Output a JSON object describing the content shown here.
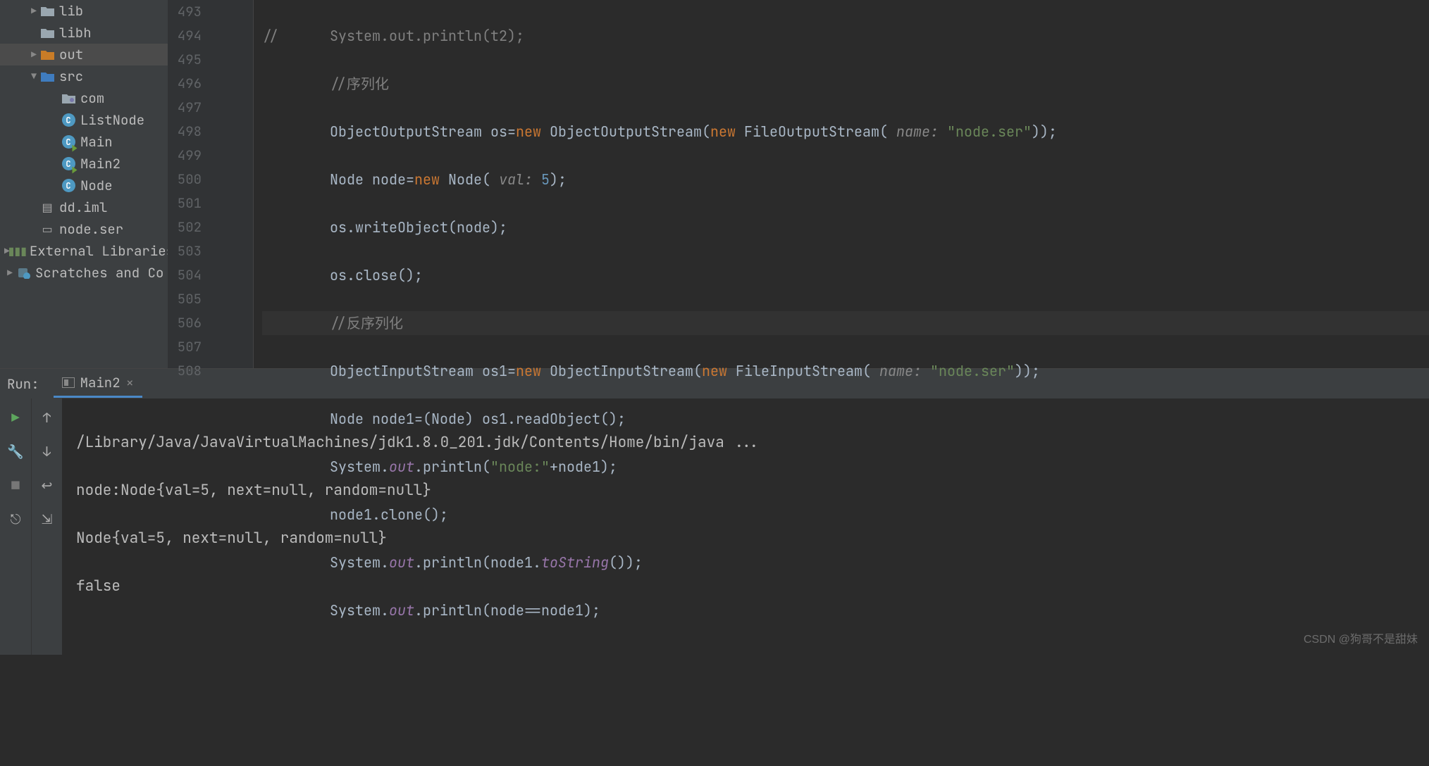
{
  "tree": {
    "lib": "lib",
    "libh": "libh",
    "out": "out",
    "src": "src",
    "com": "com",
    "listNode": "ListNode",
    "main": "Main",
    "main2": "Main2",
    "node": "Node",
    "ddIml": "dd.iml",
    "nodeSer": "node.ser",
    "externalLibs": "External Libraries",
    "scratches": "Scratches and Co"
  },
  "gutter": {
    "start": 493,
    "end": 508
  },
  "code": {
    "l493_a": "//",
    "l493_b": "      System.out.println(t2);",
    "l494": "//序列化",
    "l495_a": "ObjectOutputStream os=",
    "l495_new": "new",
    "l495_b": " ObjectOutputStream(",
    "l495_new2": "new",
    "l495_c": " FileOutputStream(",
    "l495_p": " name:",
    "l495_s": "\"node.ser\"",
    "l495_e": "));",
    "l496_a": "Node node=",
    "l496_new": "new",
    "l496_b": " Node(",
    "l496_p": " val:",
    "l496_n": " 5",
    "l496_e": ");",
    "l497": "os.writeObject(node);",
    "l498": "os.close();",
    "l499": "//反序列化",
    "l500_a": "ObjectInputStream os1=",
    "l500_new": "new",
    "l500_b": " ObjectInputStream(",
    "l500_new2": "new",
    "l500_c": " FileInputStream(",
    "l500_p": " name:",
    "l500_s": "\"node.ser\"",
    "l500_e": "));",
    "l501": "Node node1=(Node) os1.readObject();",
    "l502_a": "System.",
    "l502_out": "out",
    "l502_b": ".println(",
    "l502_s": "\"node:\"",
    "l502_c": "+node1);",
    "l503": "node1.clone();",
    "l504_a": "System.",
    "l504_out": "out",
    "l504_b": ".println(node1.",
    "l504_ts": "toString",
    "l504_c": "());",
    "l505_a": "System.",
    "l505_out": "out",
    "l505_b": ".println(node==node1);"
  },
  "run": {
    "title": "Run:",
    "tab": "Main2",
    "console": {
      "l1": "/Library/Java/JavaVirtualMachines/jdk1.8.0_201.jdk/Contents/Home/bin/java ...",
      "l2": "node:Node{val=5, next=null, random=null}",
      "l3": "Node{val=5, next=null, random=null}",
      "l4": "false"
    }
  },
  "watermark": "CSDN @狗哥不是甜妹"
}
